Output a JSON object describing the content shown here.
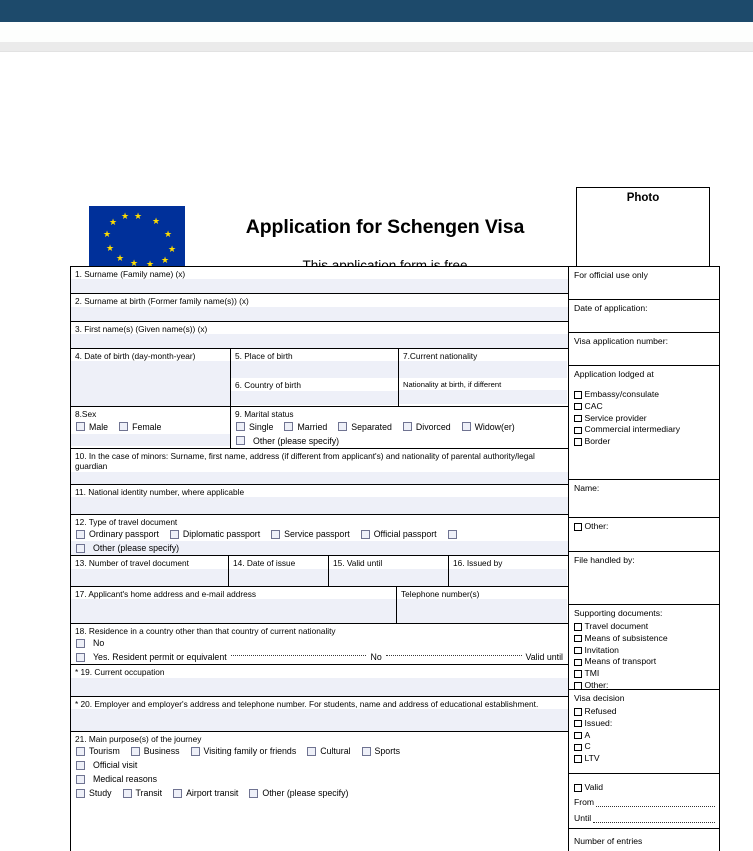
{
  "browser": {
    "header_color": "#1d4a6b"
  },
  "masthead": {
    "title": "Application for Schengen Visa",
    "subtitle": "This application form is free",
    "photo_label": "Photo",
    "flag_color": "#00309a",
    "star_color": "#ffdd00"
  },
  "form": {
    "fields": {
      "f1": "1. Surname (Family name) (x)",
      "f2": "2. Surname at birth (Former family name(s)) (x)",
      "f3": "3. First name(s) (Given name(s)) (x)",
      "f4": "4. Date of birth (day-month-year)",
      "f5": "5. Place of birth",
      "f6": "6. Country of birth",
      "f7": "7.Current nationality",
      "f7b": "Nationality at birth, if different",
      "f8": "8.Sex",
      "f9": "9. Marital status",
      "f10": "10. In the case of minors: Surname, first name, address (if different from applicant's) and nationality of parental authority/legal guardian",
      "f11": "11. National identity number, where applicable",
      "f12": "12. Type of travel document",
      "f13": "13. Number of travel document",
      "f14": "14. Date of issue",
      "f15": "15. Valid until",
      "f16": "16. Issued by",
      "f17": "17. Applicant's home address and e-mail address",
      "f17b": "Telephone number(s)",
      "f18": "18. Residence in a country other than that country of current nationality",
      "f19": "* 19. Current occupation",
      "f20": "* 20. Employer and employer's address and telephone number. For students, name and address of educational establishment.",
      "f21": "21. Main purpose(s) of the journey"
    },
    "sex_options": [
      "Male",
      "Female"
    ],
    "marital_options": [
      "Single",
      "Married",
      "Separated",
      "Divorced",
      "Widow(er)"
    ],
    "marital_other": "Other (please specify)",
    "travel_doc_options": [
      "Ordinary passport",
      "Diplomatic passport",
      "Service passport",
      "Official passport"
    ],
    "travel_doc_other": "Other (please specify)",
    "residence_no": "No",
    "residence_yes": "Yes. Resident permit or equivalent",
    "residence_mid": "No",
    "residence_end": "Valid until",
    "purpose_row1": [
      "Tourism",
      "Business",
      "Visiting family or friends",
      "Cultural",
      "Sports"
    ],
    "purpose_row2": "Official visit",
    "purpose_row3": "Medical reasons",
    "purpose_row4": [
      "Study",
      "Transit",
      "Airport transit",
      "Other (please specify)"
    ]
  },
  "official": {
    "title": "For official use only",
    "date_of_application": "Date of application:",
    "visa_application_number": "Visa application number:",
    "lodged_at_title": "Application lodged at",
    "lodged_at_options": [
      "Embassy/consulate",
      "CAC",
      "Service provider",
      "Commercial intermediary",
      "Border"
    ],
    "name_label": "Name:",
    "other_label": "Other:",
    "file_handled_by": "File handled by:",
    "supporting_title": "Supporting documents:",
    "supporting_options": [
      "Travel document",
      "Means of subsistence",
      "Invitation",
      "Means of transport",
      "TMI",
      "Other:"
    ],
    "decision_title": "Visa decision",
    "decision_options": [
      "Refused",
      "Issued:",
      "A",
      "C",
      "LTV"
    ],
    "valid_label": "Valid",
    "from_label": "From",
    "until_label": "Until",
    "entries_label": "Number of entries"
  }
}
